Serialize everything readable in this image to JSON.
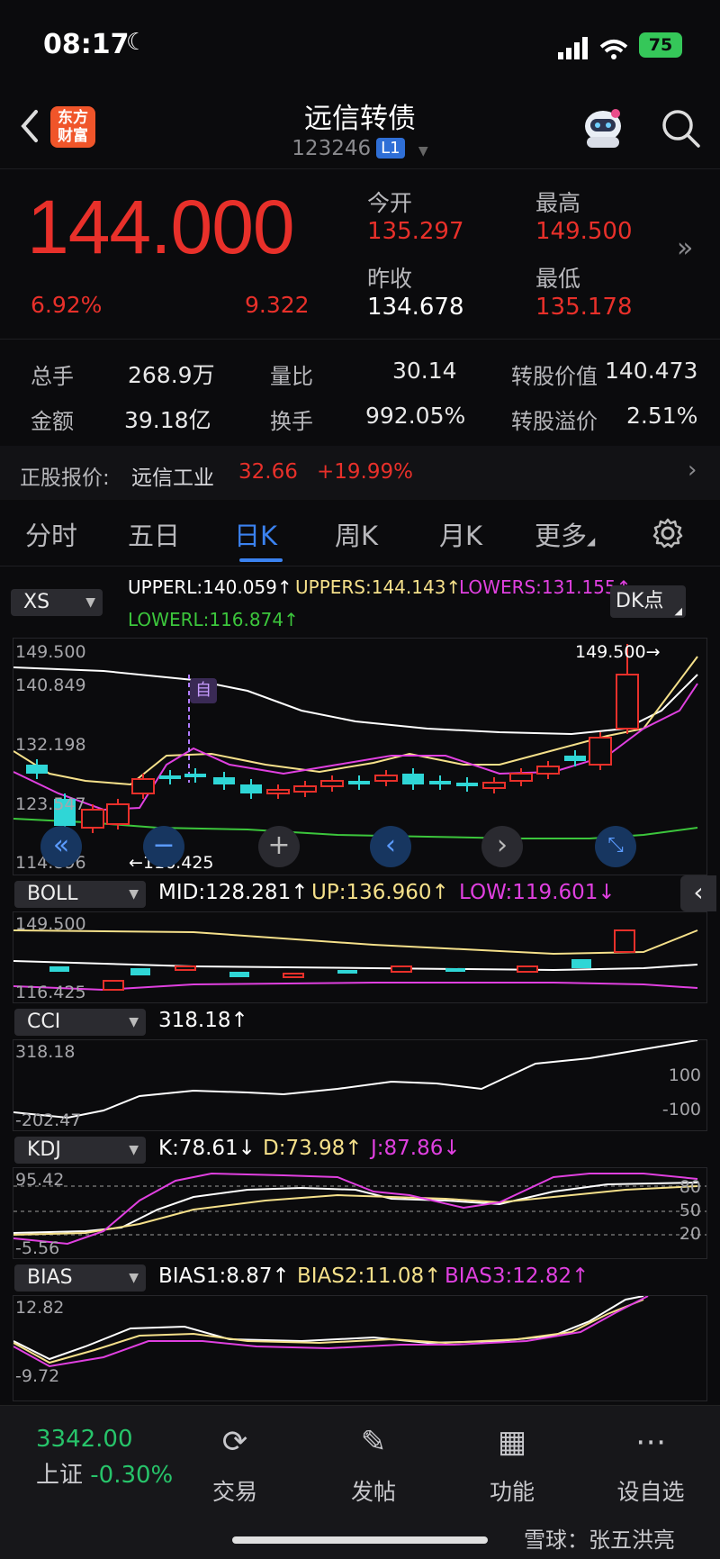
{
  "status": {
    "time": "08:17",
    "battery": "75"
  },
  "header": {
    "title": "远信转债",
    "code": "123246",
    "level_badge": "L1",
    "logo_text_1": "东方",
    "logo_text_2": "财富"
  },
  "quote": {
    "price": "144.000",
    "change_pct": "6.92%",
    "change_amt": "9.322",
    "open_label": "今开",
    "open": "135.297",
    "high_label": "最高",
    "high": "149.500",
    "prev_close_label": "昨收",
    "prev_close": "134.678",
    "low_label": "最低",
    "low": "135.178"
  },
  "stats": {
    "volume_label": "总手",
    "volume": "268.9万",
    "vol_ratio_label": "量比",
    "vol_ratio": "30.14",
    "conv_value_label": "转股价值",
    "conv_value": "140.473",
    "amount_label": "金额",
    "amount": "39.18亿",
    "turnover_label": "换手",
    "turnover": "992.05%",
    "premium_label": "转股溢价",
    "premium": "2.51%"
  },
  "underlying": {
    "label": "正股报价:",
    "name": "远信工业",
    "price": "32.66",
    "change": "+19.99%"
  },
  "tabs": [
    "分时",
    "五日",
    "日K",
    "周K",
    "月K",
    "更多"
  ],
  "main_panel": {
    "selector": "XS",
    "upperl": "UPPERL:140.059↑",
    "uppers": "UPPERS:144.143↑",
    "lowers": "LOWERS:131.155↑",
    "lowerl": "LOWERL:116.874↑",
    "dk_button": "DK点",
    "axis": [
      "149.500",
      "140.849",
      "132.198",
      "123.547",
      "114.896"
    ],
    "max_label": "149.500→",
    "min_label": "←116.425",
    "self_marker": "自"
  },
  "boll": {
    "selector": "BOLL",
    "mid": "MID:128.281↑",
    "up": "UP:136.960↑",
    "low": "LOW:119.601↓",
    "axis_top": "149.500",
    "axis_bottom": "116.425"
  },
  "cci": {
    "selector": "CCI",
    "value": "318.18↑",
    "axis_top": "318.18",
    "axis_bottom": "-202.47",
    "ref_high": "100",
    "ref_low": "-100"
  },
  "kdj": {
    "selector": "KDJ",
    "k": "K:78.61↓",
    "d": "D:73.98↑",
    "j": "J:87.86↓",
    "axis_top": "95.42",
    "axis_bottom": "-5.56",
    "ref_80": "80",
    "ref_50": "50",
    "ref_20": "20"
  },
  "bias": {
    "selector": "BIAS",
    "b1": "BIAS1:8.87↑",
    "b2": "BIAS2:11.08↑",
    "b3": "BIAS3:12.82↑",
    "axis_top": "12.82",
    "axis_bottom": "-9.72"
  },
  "bottom_bar": {
    "index_value": "3342.00",
    "index_name": "上证",
    "index_change": "-0.30%",
    "items": [
      "交易",
      "发帖",
      "功能",
      "设自选"
    ]
  },
  "watermark": "雪球：张五洪亮",
  "colors": {
    "up_red": "#e8302a",
    "down_cyan": "#2fd6d6",
    "accent_blue": "#3b82f0",
    "line_white": "#ffffff",
    "line_yellow": "#f5e08a",
    "line_magenta": "#e040e0",
    "line_green": "#3cc63c"
  }
}
